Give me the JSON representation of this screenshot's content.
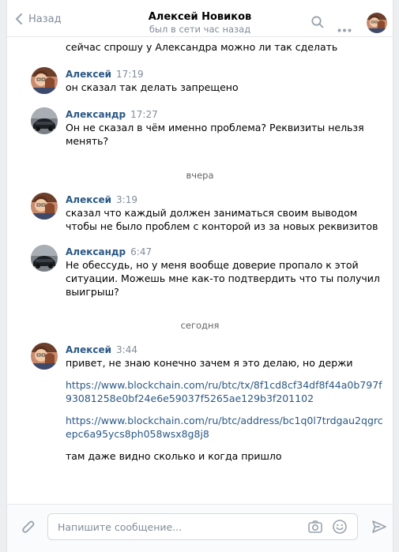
{
  "header": {
    "back_label": "Назад",
    "contact_name": "Алексей Новиков",
    "status": "был в сети час назад"
  },
  "messages": {
    "top_line": "сейчас спрошу у Александра можно ли так сделать",
    "m1": {
      "author": "Алексей",
      "time": "17:19",
      "lines": [
        "он сказал так делать запрещено"
      ]
    },
    "m2": {
      "author": "Александр",
      "time": "17:27",
      "lines": [
        "Он не сказал в чём именно проблема? Реквизиты нельзя",
        "менять?"
      ]
    },
    "divider1": "вчера",
    "m3": {
      "author": "Алексей",
      "time": "3:19",
      "lines": [
        "сказал что каждый должен заниматься своим выводом",
        "чтобы не было проблем с конторой из за новых реквизитов"
      ]
    },
    "m4": {
      "author": "Александр",
      "time": "6:47",
      "lines": [
        "Не обессудь, но у меня вообще доверие пропало к этой",
        "ситуации. Можешь мне как-то подтвердить что ты получил",
        "выигрыш?"
      ]
    },
    "divider2": "сегодня",
    "m5": {
      "author": "Алексей",
      "time": "3:44",
      "lines": [
        "привет, не знаю конечно зачем я это делаю, но держи"
      ],
      "link1": [
        "https://www.blockchain.com/ru/btc/tx/8f1cd8cf34df8f44a0b797f",
        "93081258e0bf24e6e59037f5265ae129b3f201102"
      ],
      "link2": [
        "https://www.blockchain.com/ru/btc/address/bc1q0l7trdgau2qgrc",
        "epc6a95ycs8ph058wsx8g8j8"
      ],
      "last_line": "там даже видно сколько и когда пришло"
    }
  },
  "composer": {
    "placeholder": "Напишите сообщение..."
  },
  "icons": {
    "back": "chevron-left-icon",
    "search": "search-icon",
    "more": "more-dots-icon",
    "attach": "paperclip-icon",
    "camera": "camera-icon",
    "emoji": "smile-icon",
    "send": "send-icon"
  },
  "colors": {
    "link": "#2a5885",
    "muted": "#818c99",
    "background": "#edeef0"
  }
}
